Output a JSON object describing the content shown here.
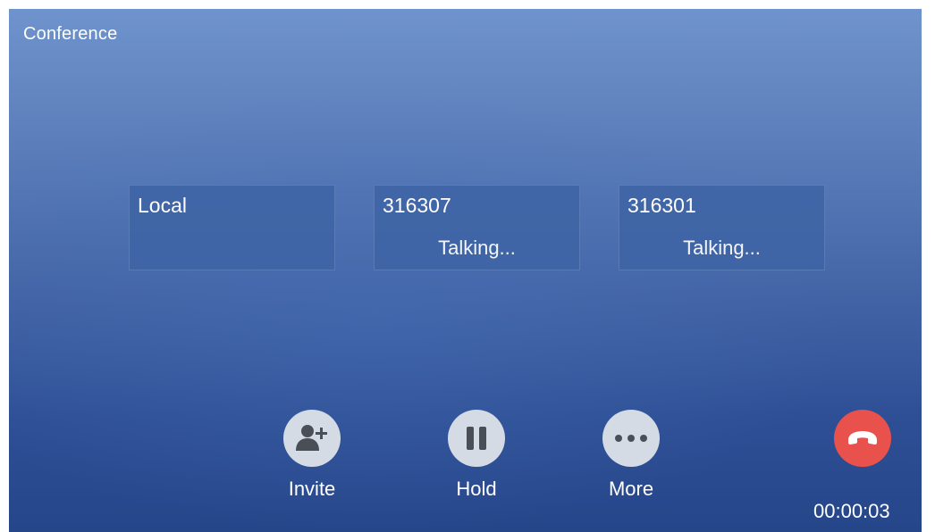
{
  "header": {
    "title": "Conference"
  },
  "participants": [
    {
      "name": "Local",
      "status": ""
    },
    {
      "name": "316307",
      "status": "Talking..."
    },
    {
      "name": "316301",
      "status": "Talking..."
    }
  ],
  "actions": {
    "invite": {
      "label": "Invite",
      "icon": "add-person-icon"
    },
    "hold": {
      "label": "Hold",
      "icon": "pause-icon"
    },
    "more": {
      "label": "More",
      "icon": "more-dots-icon"
    },
    "end": {
      "icon": "hang-up-icon"
    }
  },
  "call": {
    "duration": "00:00:03"
  },
  "colors": {
    "background_top": "#6f93cc",
    "background_bottom": "#26468a",
    "button_bg": "#d5dbe5",
    "icon": "#4a4e57",
    "end_call": "#e8514c"
  }
}
